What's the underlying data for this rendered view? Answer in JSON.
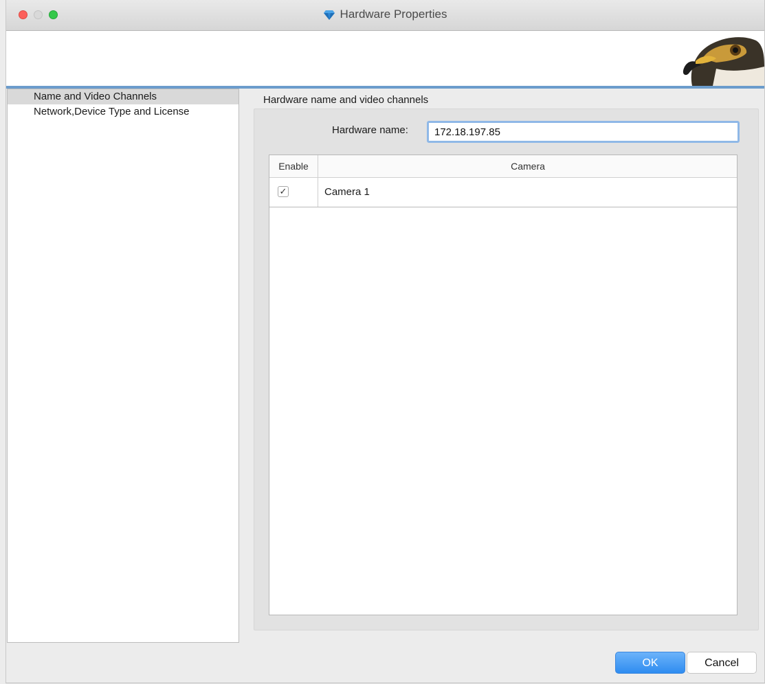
{
  "window": {
    "title": "Hardware Properties",
    "title_icon": "diamond-icon",
    "accent_color": "#6b9ccc"
  },
  "sidebar": {
    "items": [
      {
        "label": "Name and Video Channels",
        "selected": true
      },
      {
        "label": "Network,Device Type and License",
        "selected": false
      }
    ]
  },
  "main": {
    "section_title": "Hardware name and video channels",
    "hardware_name_label": "Hardware name:",
    "hardware_name_value": "172.18.197.85",
    "table": {
      "columns": [
        "Enable",
        "Camera"
      ],
      "rows": [
        {
          "enabled": true,
          "check_glyph": "✓",
          "camera": "Camera 1"
        }
      ]
    }
  },
  "buttons": {
    "ok": "OK",
    "cancel": "Cancel",
    "ok_color": "#2e8cf0"
  }
}
